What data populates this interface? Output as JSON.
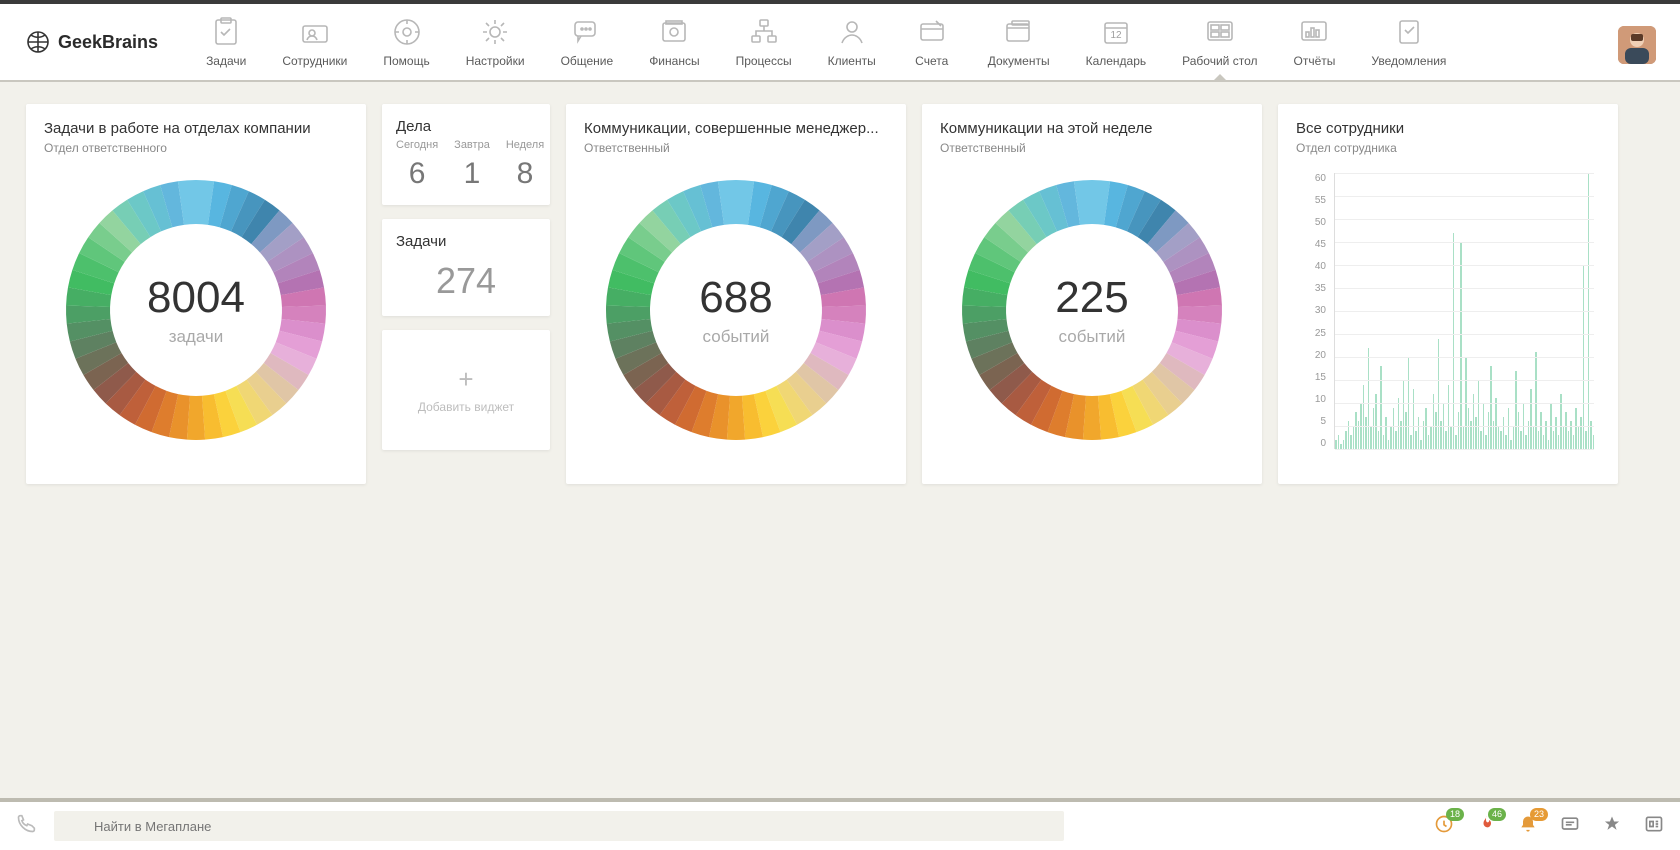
{
  "brand": "GeekBrains",
  "nav": {
    "items": [
      {
        "id": "tasks",
        "label": "Задачи"
      },
      {
        "id": "employees",
        "label": "Сотрудники"
      },
      {
        "id": "help",
        "label": "Помощь"
      },
      {
        "id": "settings",
        "label": "Настройки"
      },
      {
        "id": "chat",
        "label": "Общение"
      },
      {
        "id": "finance",
        "label": "Финансы"
      },
      {
        "id": "processes",
        "label": "Процессы"
      },
      {
        "id": "clients",
        "label": "Клиенты"
      },
      {
        "id": "accounts",
        "label": "Счета"
      },
      {
        "id": "documents",
        "label": "Документы"
      },
      {
        "id": "calendar",
        "label": "Календарь",
        "day": "12"
      },
      {
        "id": "desktop",
        "label": "Рабочий стол",
        "active": true
      },
      {
        "id": "reports",
        "label": "Отчёты"
      },
      {
        "id": "notifications",
        "label": "Уведомления"
      }
    ]
  },
  "cards": {
    "tasks_dept": {
      "title": "Задачи в работе на отделах компании",
      "subtitle": "Отдел ответственного",
      "value": "8004",
      "unit": "задачи"
    },
    "deals": {
      "title": "Дела",
      "cols": [
        {
          "h": "Сегодня",
          "v": "6"
        },
        {
          "h": "Завтра",
          "v": "1"
        },
        {
          "h": "Неделя",
          "v": "8"
        }
      ]
    },
    "tasks": {
      "title": "Задачи",
      "value": "274"
    },
    "add_widget": "Добавить виджет",
    "comm_mgr": {
      "title": "Коммуникации, совершенные менеджер...",
      "subtitle": "Ответственный",
      "value": "688",
      "unit": "событий"
    },
    "comm_week": {
      "title": "Коммуникации на этой неделе",
      "subtitle": "Ответственный",
      "value": "225",
      "unit": "событий"
    },
    "employees_chart": {
      "title": "Все сотрудники",
      "subtitle": "Отдел сотрудника"
    }
  },
  "bottom": {
    "search_placeholder": "Найти в Мегаплане",
    "badges": {
      "clock": "18",
      "fire": "46",
      "bell": "23"
    }
  },
  "chart_data": {
    "type": "bar",
    "title": "Все сотрудники",
    "subtitle": "Отдел сотрудника",
    "ylabel": "",
    "xlabel": "",
    "ylim": [
      0,
      60
    ],
    "yticks": [
      60,
      55,
      50,
      45,
      40,
      35,
      30,
      25,
      20,
      15,
      10,
      5,
      0
    ],
    "values": [
      2,
      3,
      1,
      2,
      4,
      6,
      3,
      5,
      8,
      6,
      10,
      14,
      7,
      22,
      5,
      9,
      12,
      4,
      18,
      3,
      7,
      2,
      5,
      9,
      4,
      11,
      6,
      15,
      8,
      20,
      3,
      13,
      4,
      7,
      2,
      6,
      9,
      3,
      5,
      12,
      8,
      24,
      6,
      10,
      4,
      14,
      5,
      47,
      3,
      8,
      45,
      5,
      20,
      9,
      6,
      12,
      7,
      15,
      4,
      10,
      3,
      8,
      18,
      6,
      11,
      5,
      4,
      7,
      3,
      9,
      2,
      5,
      17,
      8,
      4,
      10,
      3,
      6,
      13,
      5,
      21,
      4,
      8,
      3,
      6,
      2,
      10,
      4,
      7,
      3,
      12,
      5,
      8,
      4,
      6,
      3,
      9,
      5,
      7,
      40,
      4,
      62,
      6,
      3
    ]
  },
  "donut_palette": [
    "#72c7e7",
    "#58b6e0",
    "#4fa6d0",
    "#4795be",
    "#3f85ad",
    "#7e99c2",
    "#a39fc6",
    "#ad92c1",
    "#b284bb",
    "#b473b2",
    "#cf76b2",
    "#d582bd",
    "#db8fcc",
    "#e49fd6",
    "#e7b0da",
    "#dfb9bf",
    "#e0c6a6",
    "#e9cf8f",
    "#f0d774",
    "#f6de54",
    "#fbd23c",
    "#f8bd30",
    "#f1a72c",
    "#e9922b",
    "#de7d2d",
    "#d06b31",
    "#bf603a",
    "#a85a42",
    "#8f5a4b",
    "#7b6451",
    "#6c725a",
    "#5e8161",
    "#549064",
    "#4c9f65",
    "#46ae64",
    "#41bc62",
    "#4dc06c",
    "#60c67b",
    "#79cd8d",
    "#93d49f",
    "#77ceb5",
    "#6cc8c7",
    "#66c0d4",
    "#63b7dd",
    "#72c7e7"
  ]
}
